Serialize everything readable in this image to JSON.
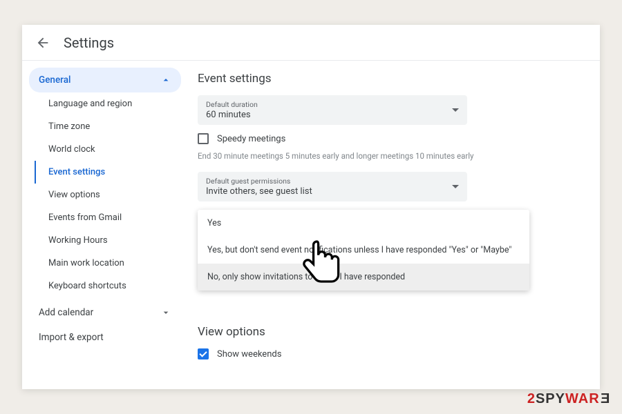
{
  "header": {
    "title": "Settings"
  },
  "sidebar": {
    "groups": [
      {
        "label": "General",
        "expanded": true
      },
      {
        "label": "Add calendar",
        "expanded": false
      },
      {
        "label": "Import & export",
        "expanded": false
      }
    ],
    "general_items": [
      "Language and region",
      "Time zone",
      "World clock",
      "Event settings",
      "View options",
      "Events from Gmail",
      "Working Hours",
      "Main work location",
      "Keyboard shortcuts"
    ],
    "active_item_index": 3
  },
  "event_settings": {
    "section_title": "Event settings",
    "duration": {
      "field_label": "Default duration",
      "value": "60 minutes"
    },
    "speedy": {
      "label": "Speedy meetings",
      "checked": false
    },
    "speedy_helper": "End 30 minute meetings 5 minutes early and longer meetings 10 minutes early",
    "guest_perm": {
      "field_label": "Default guest permissions",
      "value": "Invite others, see guest list"
    },
    "auto_add_options": [
      "Yes",
      "Yes, but don't send event notifications unless I have responded \"Yes\" or \"Maybe\"",
      "No, only show invitations to which I have responded"
    ],
    "hover_option_index": 2
  },
  "view_options": {
    "section_title": "View options",
    "show_weekends": {
      "label": "Show weekends",
      "checked": true
    }
  },
  "watermark": {
    "two": "2",
    "spy": "SPY",
    "war": "WAR",
    "e": "E"
  }
}
